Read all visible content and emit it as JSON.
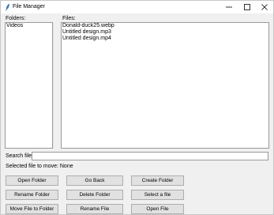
{
  "window": {
    "title": "File Manager"
  },
  "labels": {
    "folders": "Folders:",
    "files": "Files:",
    "search": "Search file:",
    "selected_status": "Selected file to move: None"
  },
  "folders": [
    "Videos"
  ],
  "files": [
    "Donald-duck25.webp",
    "Untitled design.mp3",
    "Untitled design.mp4"
  ],
  "search": {
    "value": ""
  },
  "buttons": {
    "open_folder": "Open Folder",
    "go_back": "Go Back",
    "create_folder": "Create Folder",
    "rename_folder": "Rename Folder",
    "delete_folder": "Delete Folder",
    "select_file": "Select a file",
    "move_file": "Move File to Folder",
    "rename_file": "Rename File",
    "open_file": "Open File"
  },
  "icons": {
    "app": "feather-icon",
    "minimize": "minimize-icon",
    "maximize": "maximize-icon",
    "close": "close-icon"
  }
}
